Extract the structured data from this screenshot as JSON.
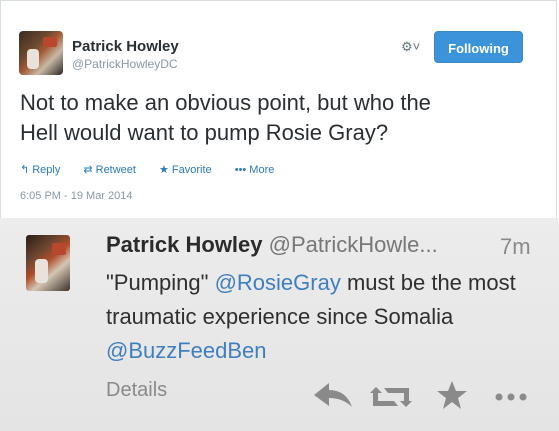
{
  "tweet": {
    "author_name": "Patrick Howley",
    "author_handle": "@PatrickHowleyDC",
    "follow_label": "Following",
    "gear_glyph": "⚙˅",
    "text_line1": "Not to make an obvious point, but who the",
    "text_line2": "Hell would want to pump Rosie Gray?",
    "actions": {
      "reply": "Reply",
      "retweet": "Retweet",
      "favorite": "Favorite",
      "more": "More"
    },
    "timestamp": "6:05 PM - 19 Mar 2014"
  },
  "embedded": {
    "author_name": "Patrick Howley",
    "author_handle": "@PatrickHowle...",
    "time": "7m",
    "text_part1": "\"Pumping\"",
    "mention1": "@RosieGray",
    "text_part2": "must be the most traumatic experience since Somalia",
    "mention2": "@BuzzFeedBen",
    "details_label": "Details"
  }
}
